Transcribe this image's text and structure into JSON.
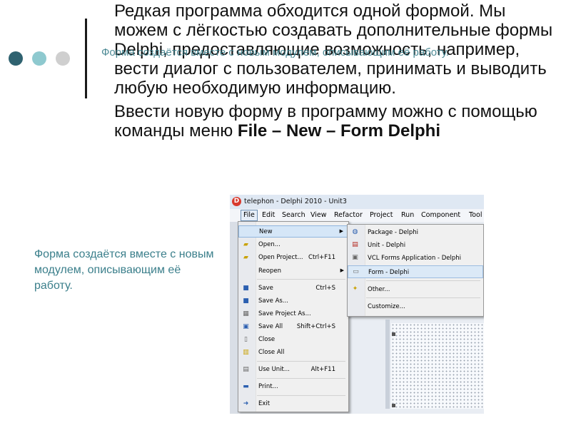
{
  "slide": {
    "ghost_text": "Форма создаётся вместе с новым модулем, описывающим её работу.",
    "bullet_symbol": "",
    "bullet1": "Редкая программа обходится одной формой. Мы можем с лёгкостью создавать дополнительные формы Delphi, предоставляющие возможность, например, вести диалог с пользователем, принимать и выводить любую необходимую информацию.",
    "bullet2_prefix": "Ввести новую форму в программу можно с помощью команды меню ",
    "bullet2_bold": "File – New – Form Delphi",
    "caption": "Форма создаётся вместе с новым модулем, описывающим её работу."
  },
  "screenshot": {
    "title": "telephon - Delphi 2010 - Unit3",
    "app_icon_glyph": "D",
    "menubar": [
      "File",
      "Edit",
      "Search",
      "View",
      "Refactor",
      "Project",
      "Run",
      "Component",
      "Tool"
    ],
    "file_menu": [
      {
        "label": "New",
        "shortcut": "",
        "submenu": true,
        "icon": "none"
      },
      {
        "label": "Open...",
        "shortcut": "",
        "icon": "open-folder-icon"
      },
      {
        "label": "Open Project...",
        "shortcut": "Ctrl+F11",
        "icon": "open-project-icon"
      },
      {
        "label": "Reopen",
        "shortcut": "",
        "submenu": true,
        "icon": "none"
      },
      {
        "label": "Save",
        "shortcut": "Ctrl+S",
        "icon": "save-icon"
      },
      {
        "label": "Save As...",
        "shortcut": "",
        "icon": "save-as-icon"
      },
      {
        "label": "Save Project As...",
        "shortcut": "",
        "icon": "save-project-icon"
      },
      {
        "label": "Save All",
        "shortcut": "Shift+Ctrl+S",
        "icon": "save-all-icon"
      },
      {
        "label": "Close",
        "shortcut": "",
        "icon": "close-file-icon"
      },
      {
        "label": "Close All",
        "shortcut": "",
        "icon": "close-all-icon"
      },
      {
        "label": "Use Unit...",
        "shortcut": "Alt+F11",
        "icon": "use-unit-icon"
      },
      {
        "label": "Print...",
        "shortcut": "",
        "icon": "print-icon"
      },
      {
        "label": "Exit",
        "shortcut": "",
        "icon": "exit-icon"
      }
    ],
    "new_submenu": [
      {
        "label": "Package - Delphi",
        "icon": "package-icon"
      },
      {
        "label": "Unit - Delphi",
        "icon": "unit-icon"
      },
      {
        "label": "VCL Forms Application - Delphi",
        "icon": "vcl-app-icon"
      },
      {
        "label": "Form - Delphi",
        "icon": "form-icon",
        "highlighted": true
      },
      {
        "label": "Other...",
        "icon": "other-icon"
      },
      {
        "label": "Customize...",
        "icon": "none"
      }
    ]
  },
  "colors": {
    "accent_teal": "#3b7f8b",
    "dot_dark": "#2f6270",
    "dot_light": "#8ec9cf",
    "dot_gray": "#cfcfcf",
    "menu_highlight": "#d5e6f7"
  }
}
